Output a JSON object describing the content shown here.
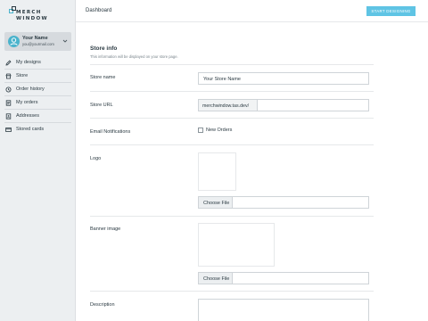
{
  "brand": {
    "line1": "MERCH",
    "line2": "WINDOW"
  },
  "user": {
    "name": "Your Name",
    "email": "you@yourmail.com"
  },
  "sidebar": {
    "items": [
      {
        "label": "My designs"
      },
      {
        "label": "Store"
      },
      {
        "label": "Order history"
      },
      {
        "label": "My orders"
      },
      {
        "label": "Addresses"
      },
      {
        "label": "Stored cards"
      }
    ]
  },
  "header": {
    "title": "Dashboard",
    "cta_label": "START DESIGNING"
  },
  "store_info": {
    "title": "Store info",
    "subtitle": "This information will be displayed on your store page.",
    "store_name": {
      "label": "Store name",
      "value": "Your Store Name"
    },
    "store_url": {
      "label": "Store URL",
      "prefix": "merchwindow.tas.dev/",
      "value": ""
    },
    "email_notifications": {
      "label": "Email Notifications",
      "option_label": "New Orders",
      "checked": false
    },
    "logo": {
      "label": "Logo",
      "button_label": "Choose File"
    },
    "banner": {
      "label": "Banner image",
      "button_label": "Choose File"
    },
    "description": {
      "label": "Description"
    }
  },
  "colors": {
    "accent": "#5fc4e4",
    "sidebar_bg": "#eceff1",
    "avatar": "#4ab3cc"
  }
}
